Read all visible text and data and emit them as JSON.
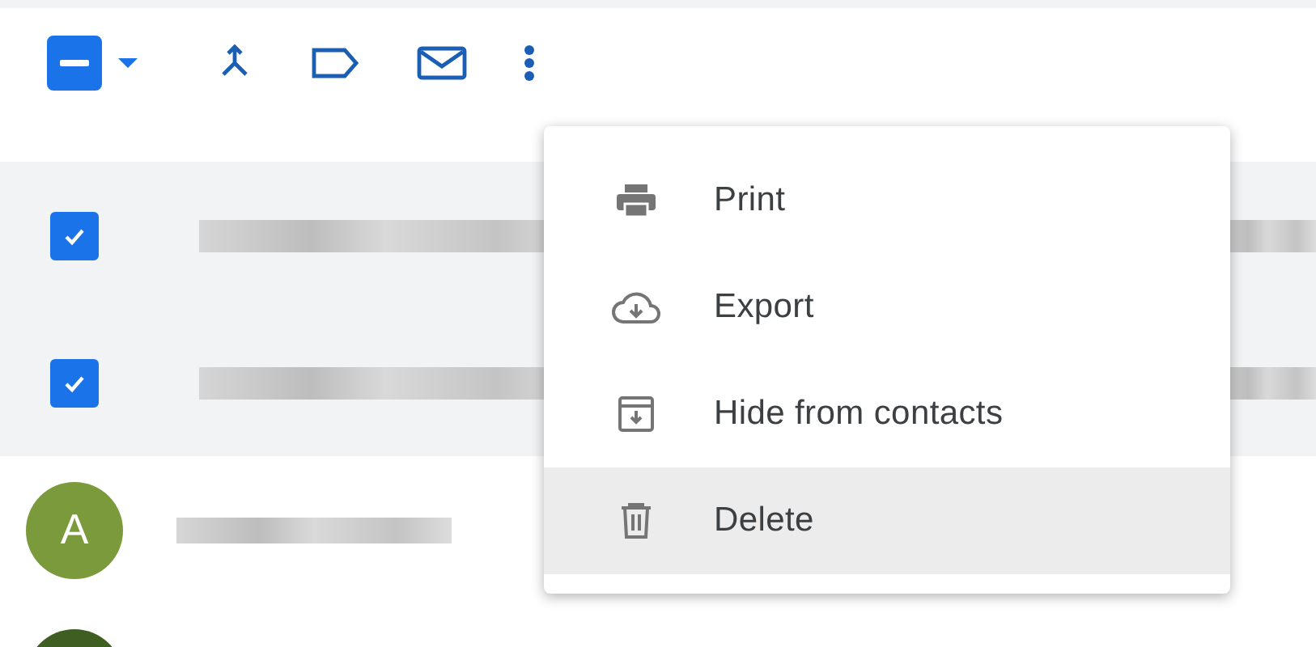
{
  "toolbar": {
    "select_checkbox": {
      "indeterminate": true
    }
  },
  "rows": [
    {
      "kind": "checkbox",
      "checked": true,
      "selected": true
    },
    {
      "kind": "checkbox",
      "checked": true,
      "selected": true
    },
    {
      "kind": "avatar",
      "letter": "A",
      "color": "#7b9a3b",
      "selected": false
    },
    {
      "kind": "avatar",
      "color": "#3f5f22",
      "selected": false
    }
  ],
  "menu": {
    "items": [
      {
        "kind": "print",
        "label": "Print",
        "selected": false
      },
      {
        "kind": "export",
        "label": "Export",
        "selected": false
      },
      {
        "kind": "hide",
        "label": "Hide from contacts",
        "selected": false
      },
      {
        "kind": "delete",
        "label": "Delete",
        "selected": true
      }
    ]
  }
}
